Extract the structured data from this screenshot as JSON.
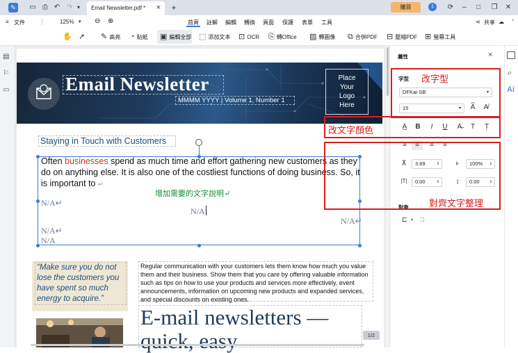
{
  "titlebar": {
    "tab_title": "Email Newsletter.pdf *",
    "tab_close": "×",
    "new_tab": "+",
    "zoom_undo": "▾",
    "buy_label": "購買",
    "badge_count": "1"
  },
  "menubar": {
    "file_label": "文件",
    "zoom_value": "125%",
    "items": [
      "首頁",
      "註解",
      "編輯",
      "轉換",
      "頁面",
      "保護",
      "表單",
      "工具"
    ],
    "share_label": "共享"
  },
  "toolbar": {
    "tools": [
      "高亮",
      "貼紙",
      "編輯全部",
      "添加文本",
      "OCR",
      "轉Office",
      "轉圖像",
      "合併PDF",
      "壓縮PDF",
      "螢幕工具"
    ]
  },
  "document": {
    "banner_title": "Email Newsletter",
    "banner_subtitle": "MMMM YYYY  |  Volume 1, Number 1",
    "logo_placeholder": [
      "Place",
      "Your",
      "Logo",
      "Here"
    ],
    "heading": "Staying in Touch with Customers",
    "body_pre": "Often ",
    "body_highlight": "businesses",
    "body_post": " spend as much time and effort gathering new customers as they do on anything else. It is also one of the costliest functions of doing business. So, it is important to",
    "body_mark": "↵",
    "note": "增加需要的文字說明↵",
    "placeholders": [
      "N/A↵",
      "N/A",
      "N/A↵",
      "N/A↵",
      "N/A"
    ],
    "quote": "“Make sure you do not lose the customers you have spent so much energy to acquire.”",
    "para2": "Regular communication with your customers lets them know how much you value them and their business. Show them that you care by offering valuable information such as tips on how to use your products and services more effectively, event announcements, information on upcoming new products and expanded services, and special discounts on existing ones.",
    "big_heading_1": "E-mail newsletters —",
    "big_heading_2": "quick, easy",
    "page_indicator": "1/2"
  },
  "panel": {
    "title": "屬性",
    "close": "×",
    "font_section": "字型",
    "font_name": "DFKai-SB",
    "font_size": "15",
    "spacing_char": "3.69",
    "spacing_scale": "100%",
    "indent_value": "0.00",
    "line_value": "0.00",
    "object_section": "對象",
    "ai_label": "Ai"
  },
  "annotations": {
    "font_change": "改字型",
    "color_change": "改文字顏色",
    "align_change": "對齊文字整理"
  },
  "colors": {
    "annotation": "#d81e1e",
    "accent": "#3a7bd5",
    "buy_button": "#f7b56a",
    "banner": "#1c3149",
    "note_green": "#1a8a3e",
    "highlight_red": "#c0392b"
  }
}
